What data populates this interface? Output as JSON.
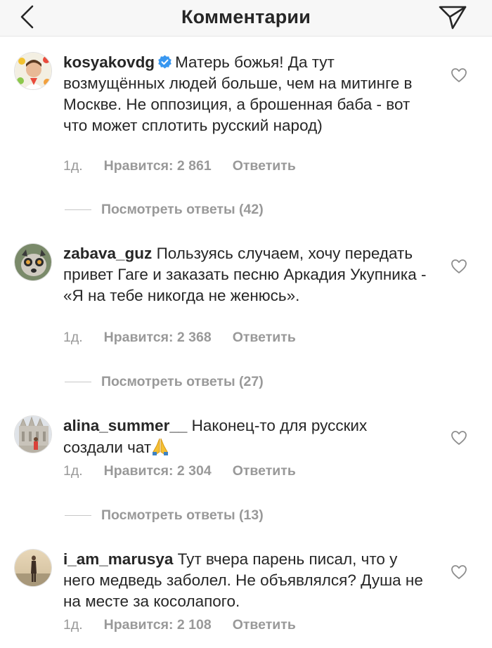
{
  "header": {
    "title": "Комментарии",
    "back_icon": "chevron-left-icon",
    "share_icon": "paper-plane-icon"
  },
  "comments": [
    {
      "username": "kosyakovdg",
      "verified": true,
      "text": "Матерь божья! Да тут возмущённых людей больше, чем на митинге в Москве. Не оппозиция, а брошенная баба - вот что может сплотить русский народ)",
      "age": "1д.",
      "likes": "Нравится: 2 861",
      "reply": "Ответить",
      "view_replies": "Посмотреть ответы (42)"
    },
    {
      "username": "zabava_guz",
      "verified": false,
      "text": "Пользуясь случаем, хочу передать привет Гаге и заказать песню Аркадия Укупника - «Я на тебе никогда не женюсь».",
      "age": "1д.",
      "likes": "Нравится: 2 368",
      "reply": "Ответить",
      "view_replies": "Посмотреть ответы (27)"
    },
    {
      "username": "alina_summer__",
      "verified": false,
      "text": "Наконец-то для русских создали чат",
      "emoji": "folded-hands-emoji",
      "age": "1д.",
      "likes": "Нравится: 2 304",
      "reply": "Ответить",
      "view_replies": "Посмотреть ответы (13)"
    },
    {
      "username": "i_am_marusya",
      "verified": false,
      "text": "Тут вчера парень писал, что у него медведь заболел. Не объявлялся? Душа не на месте за косолапого.",
      "age": "1д.",
      "likes": "Нравится: 2 108",
      "reply": "Ответить"
    }
  ],
  "colors": {
    "primary_text": "#262626",
    "secondary_text": "#999999",
    "verified_blue": "#3897f0",
    "header_bg": "#f7f7f7"
  }
}
